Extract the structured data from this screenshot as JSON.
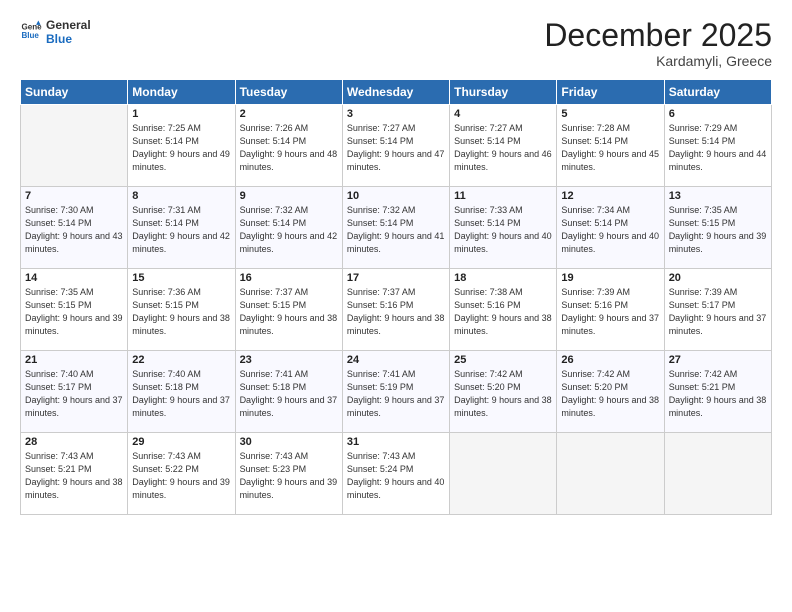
{
  "header": {
    "logo_line1": "General",
    "logo_line2": "Blue",
    "month": "December 2025",
    "location": "Kardamyli, Greece"
  },
  "weekdays": [
    "Sunday",
    "Monday",
    "Tuesday",
    "Wednesday",
    "Thursday",
    "Friday",
    "Saturday"
  ],
  "weeks": [
    [
      {
        "day": "",
        "empty": true
      },
      {
        "day": "1",
        "sunrise": "7:25 AM",
        "sunset": "5:14 PM",
        "daylight": "9 hours and 49 minutes."
      },
      {
        "day": "2",
        "sunrise": "7:26 AM",
        "sunset": "5:14 PM",
        "daylight": "9 hours and 48 minutes."
      },
      {
        "day": "3",
        "sunrise": "7:27 AM",
        "sunset": "5:14 PM",
        "daylight": "9 hours and 47 minutes."
      },
      {
        "day": "4",
        "sunrise": "7:27 AM",
        "sunset": "5:14 PM",
        "daylight": "9 hours and 46 minutes."
      },
      {
        "day": "5",
        "sunrise": "7:28 AM",
        "sunset": "5:14 PM",
        "daylight": "9 hours and 45 minutes."
      },
      {
        "day": "6",
        "sunrise": "7:29 AM",
        "sunset": "5:14 PM",
        "daylight": "9 hours and 44 minutes."
      }
    ],
    [
      {
        "day": "7",
        "sunrise": "7:30 AM",
        "sunset": "5:14 PM",
        "daylight": "9 hours and 43 minutes."
      },
      {
        "day": "8",
        "sunrise": "7:31 AM",
        "sunset": "5:14 PM",
        "daylight": "9 hours and 42 minutes."
      },
      {
        "day": "9",
        "sunrise": "7:32 AM",
        "sunset": "5:14 PM",
        "daylight": "9 hours and 42 minutes."
      },
      {
        "day": "10",
        "sunrise": "7:32 AM",
        "sunset": "5:14 PM",
        "daylight": "9 hours and 41 minutes."
      },
      {
        "day": "11",
        "sunrise": "7:33 AM",
        "sunset": "5:14 PM",
        "daylight": "9 hours and 40 minutes."
      },
      {
        "day": "12",
        "sunrise": "7:34 AM",
        "sunset": "5:14 PM",
        "daylight": "9 hours and 40 minutes."
      },
      {
        "day": "13",
        "sunrise": "7:35 AM",
        "sunset": "5:15 PM",
        "daylight": "9 hours and 39 minutes."
      }
    ],
    [
      {
        "day": "14",
        "sunrise": "7:35 AM",
        "sunset": "5:15 PM",
        "daylight": "9 hours and 39 minutes."
      },
      {
        "day": "15",
        "sunrise": "7:36 AM",
        "sunset": "5:15 PM",
        "daylight": "9 hours and 38 minutes."
      },
      {
        "day": "16",
        "sunrise": "7:37 AM",
        "sunset": "5:15 PM",
        "daylight": "9 hours and 38 minutes."
      },
      {
        "day": "17",
        "sunrise": "7:37 AM",
        "sunset": "5:16 PM",
        "daylight": "9 hours and 38 minutes."
      },
      {
        "day": "18",
        "sunrise": "7:38 AM",
        "sunset": "5:16 PM",
        "daylight": "9 hours and 38 minutes."
      },
      {
        "day": "19",
        "sunrise": "7:39 AM",
        "sunset": "5:16 PM",
        "daylight": "9 hours and 37 minutes."
      },
      {
        "day": "20",
        "sunrise": "7:39 AM",
        "sunset": "5:17 PM",
        "daylight": "9 hours and 37 minutes."
      }
    ],
    [
      {
        "day": "21",
        "sunrise": "7:40 AM",
        "sunset": "5:17 PM",
        "daylight": "9 hours and 37 minutes."
      },
      {
        "day": "22",
        "sunrise": "7:40 AM",
        "sunset": "5:18 PM",
        "daylight": "9 hours and 37 minutes."
      },
      {
        "day": "23",
        "sunrise": "7:41 AM",
        "sunset": "5:18 PM",
        "daylight": "9 hours and 37 minutes."
      },
      {
        "day": "24",
        "sunrise": "7:41 AM",
        "sunset": "5:19 PM",
        "daylight": "9 hours and 37 minutes."
      },
      {
        "day": "25",
        "sunrise": "7:42 AM",
        "sunset": "5:20 PM",
        "daylight": "9 hours and 38 minutes."
      },
      {
        "day": "26",
        "sunrise": "7:42 AM",
        "sunset": "5:20 PM",
        "daylight": "9 hours and 38 minutes."
      },
      {
        "day": "27",
        "sunrise": "7:42 AM",
        "sunset": "5:21 PM",
        "daylight": "9 hours and 38 minutes."
      }
    ],
    [
      {
        "day": "28",
        "sunrise": "7:43 AM",
        "sunset": "5:21 PM",
        "daylight": "9 hours and 38 minutes."
      },
      {
        "day": "29",
        "sunrise": "7:43 AM",
        "sunset": "5:22 PM",
        "daylight": "9 hours and 39 minutes."
      },
      {
        "day": "30",
        "sunrise": "7:43 AM",
        "sunset": "5:23 PM",
        "daylight": "9 hours and 39 minutes."
      },
      {
        "day": "31",
        "sunrise": "7:43 AM",
        "sunset": "5:24 PM",
        "daylight": "9 hours and 40 minutes."
      },
      {
        "day": "",
        "empty": true
      },
      {
        "day": "",
        "empty": true
      },
      {
        "day": "",
        "empty": true
      }
    ]
  ]
}
